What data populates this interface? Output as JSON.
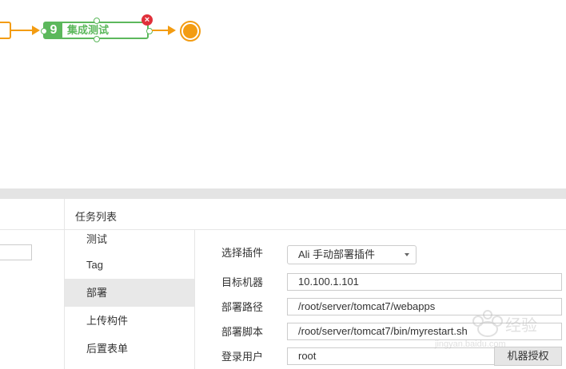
{
  "pipeline": {
    "stage": {
      "number": "9",
      "name": "集成测试"
    },
    "close_glyph": "×",
    "colors": {
      "stage_green": "#5cb85c",
      "flow_orange": "#f39c12",
      "close_red": "#e0303a"
    }
  },
  "panel": {
    "title": "任务列表",
    "nav_items": [
      {
        "label": "测试",
        "active": false
      },
      {
        "label": "Tag",
        "active": false
      },
      {
        "label": "部署",
        "active": true
      },
      {
        "label": "上传构件",
        "active": false
      },
      {
        "label": "后置表单",
        "active": false
      }
    ],
    "form": {
      "plugin": {
        "label": "选择插件",
        "value": "Ali 手动部署插件"
      },
      "target_machine": {
        "label": "目标机器",
        "value": "10.100.1.101"
      },
      "deploy_path": {
        "label": "部署路径",
        "value": "/root/server/tomcat7/webapps"
      },
      "deploy_script": {
        "label": "部署脚本",
        "value": "/root/server/tomcat7/bin/myrestart.sh"
      },
      "login_user": {
        "label": "登录用户",
        "value": "root"
      },
      "auth_button": "机器授权"
    }
  },
  "watermark": {
    "brand": "Baidu 经验",
    "domain": "jingyan.baidu.com"
  }
}
